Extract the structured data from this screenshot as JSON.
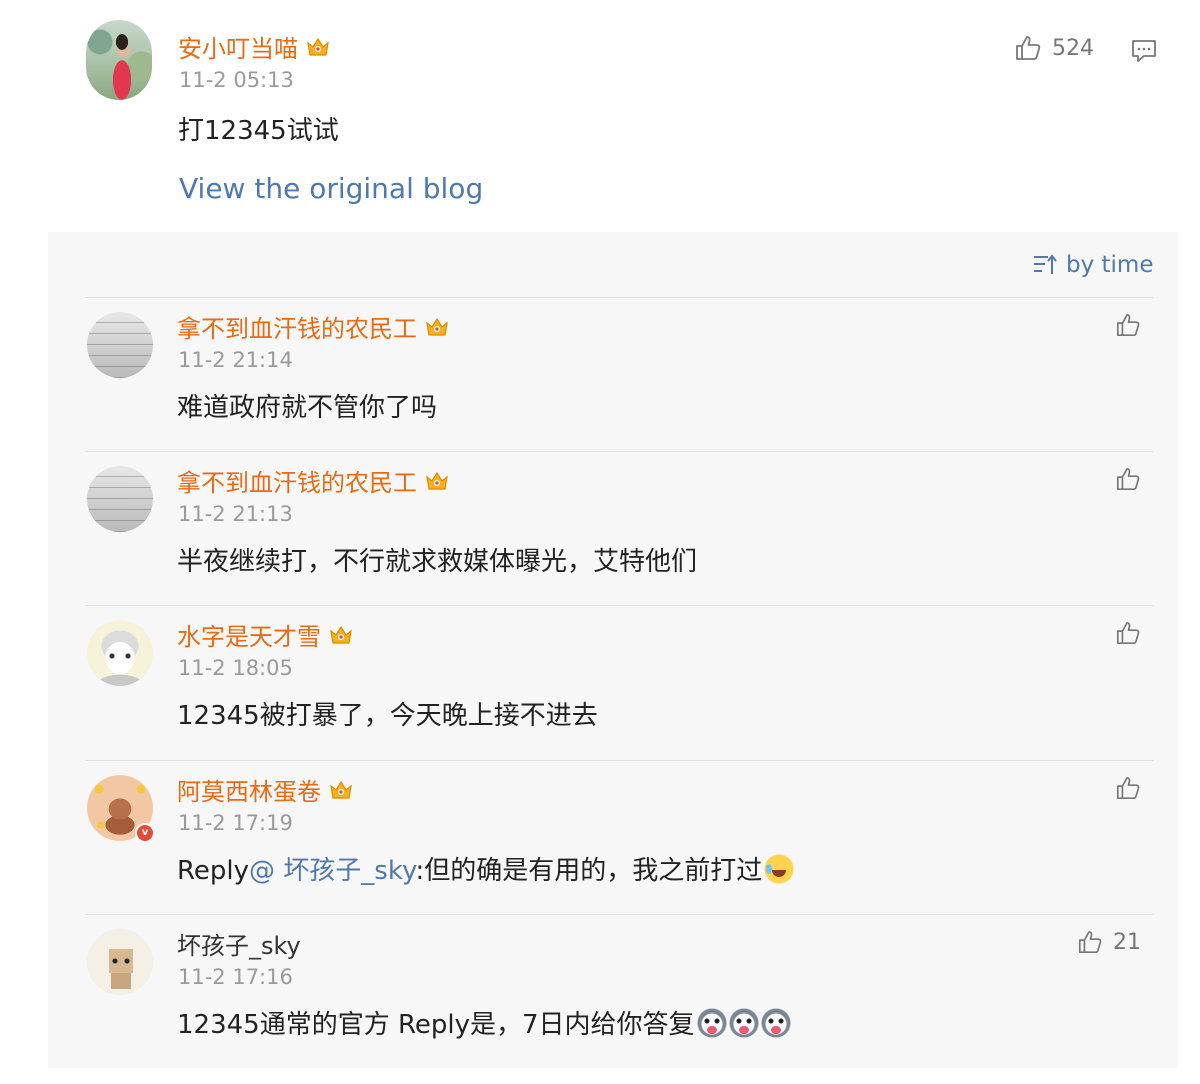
{
  "main_post": {
    "username": "安小叮当喵",
    "timestamp": "11-2 05:13",
    "content": "打12345试试",
    "like_count": "524",
    "view_original_label": "View the original blog"
  },
  "sort": {
    "label": "by time"
  },
  "comments": [
    {
      "username": "拿不到血汗钱的农民工",
      "timestamp": "11-2 21:14",
      "content": "难道政府就不管你了吗",
      "like_count": ""
    },
    {
      "username": "拿不到血汗钱的农民工",
      "timestamp": "11-2 21:13",
      "content": "半夜继续打，不行就求救媒体曝光，艾特他们",
      "like_count": ""
    },
    {
      "username": "水字是天才雪",
      "timestamp": "11-2 18:05",
      "content": "12345被打暴了，今天晚上接不进去",
      "like_count": ""
    },
    {
      "username": "阿莫西林蛋卷",
      "timestamp": "11-2 17:19",
      "reply_prefix": "Reply",
      "mention": "@ 坏孩子_sky",
      "content": ":但的确是有用的，我之前打过",
      "like_count": ""
    },
    {
      "username": "坏孩子_sky",
      "timestamp": "11-2 17:16",
      "content": "12345通常的官方 Reply是，7日内给你答复",
      "like_count": "21"
    }
  ],
  "colors": {
    "username": "#ea6a14",
    "link": "#4e79ae",
    "timestamp": "#9a9a9a",
    "panel_bg": "#f7f7f7"
  },
  "icons": {
    "crown": "vip-crown-icon",
    "like": "thumbs-up-icon",
    "comment": "comment-icon",
    "sort": "sort-by-time-icon"
  }
}
